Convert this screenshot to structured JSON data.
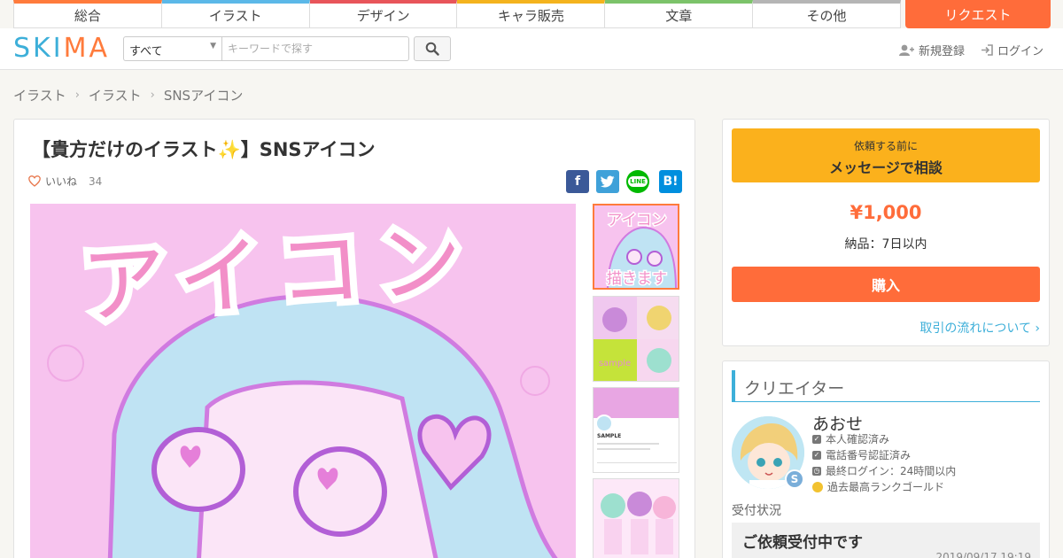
{
  "categories": [
    {
      "label": "総合",
      "color": "#ff7b3c"
    },
    {
      "label": "イラスト",
      "color": "#5bb8e8"
    },
    {
      "label": "デザイン",
      "color": "#e8555a"
    },
    {
      "label": "キャラ販売",
      "color": "#f4b31e"
    },
    {
      "label": "文章",
      "color": "#7cc36a"
    },
    {
      "label": "その他",
      "color": "#b5b5b5"
    }
  ],
  "request_label": "リクエスト",
  "header": {
    "logo_text": "SKIMA",
    "search_scope": "すべて",
    "search_placeholder": "キーワードで探す",
    "register_label": "新規登録",
    "login_label": "ログイン"
  },
  "breadcrumb": [
    "イラスト",
    "イラスト",
    "SNSアイコン"
  ],
  "product": {
    "title": "【貴方だけのイラスト✨】SNSアイコン",
    "like_label": "いいね",
    "like_count": "34",
    "main_image_text": "アイコン",
    "share": [
      {
        "icon": "facebook-icon",
        "glyph": "f",
        "color": "#3b5998"
      },
      {
        "icon": "twitter-icon",
        "glyph": "t",
        "color": "#3fa1d9"
      },
      {
        "icon": "line-icon",
        "glyph": "LINE",
        "color": "#00b900"
      },
      {
        "icon": "hatena-icon",
        "glyph": "B!",
        "color": "#008fde"
      }
    ],
    "thumbnails": [
      {
        "caption_top": "アイコン",
        "caption_bottom": "描きます"
      },
      {
        "caption": "sample"
      },
      {
        "caption": "SAMPLE"
      },
      {
        "caption": ""
      }
    ]
  },
  "order": {
    "message_small": "依頼する前に",
    "message_big": "メッセージで相談",
    "price": "¥1,000",
    "delivery": "納品：7日以内",
    "buy_label": "購入",
    "flow_link": "取引の流れについて ›"
  },
  "creator": {
    "heading": "クリエイター",
    "name": "あおせ",
    "badge": "S",
    "stats": [
      "本人確認済み",
      "電話番号認証済み",
      "最終ログイン：24時間以内",
      "過去最高ランクゴールド"
    ],
    "reception_label": "受付状況",
    "reception_status": "ご依頼受付中です",
    "reception_date": "2019/09/17 19:19"
  }
}
